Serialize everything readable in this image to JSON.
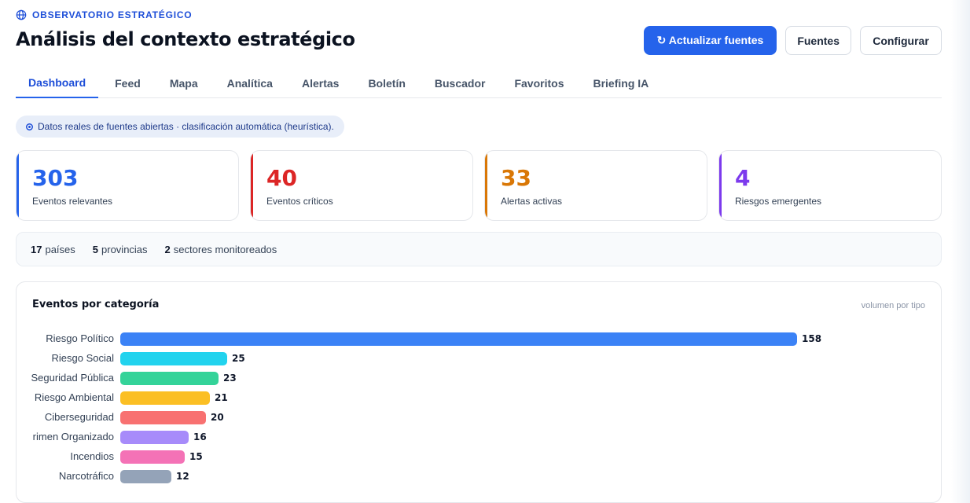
{
  "header": {
    "eyebrow": "OBSERVATORIO ESTRATÉGICO",
    "title": "Análisis del contexto estratégico",
    "actions": {
      "refresh": "↻ Actualizar fuentes",
      "sources": "Fuentes",
      "configure": "Configurar"
    },
    "accent": "#2563eb"
  },
  "tabs": [
    {
      "label": "Dashboard",
      "active": true
    },
    {
      "label": "Feed"
    },
    {
      "label": "Mapa"
    },
    {
      "label": "Analítica"
    },
    {
      "label": "Alertas"
    },
    {
      "label": "Boletín"
    },
    {
      "label": "Buscador"
    },
    {
      "label": "Favoritos"
    },
    {
      "label": "Briefing IA"
    }
  ],
  "info": "Datos reales de fuentes abiertas · clasificación automática (heurística).",
  "stats": [
    {
      "value": "303",
      "label": "Eventos relevantes",
      "color": "#2563eb"
    },
    {
      "value": "40",
      "label": "Eventos críticos",
      "color": "#dc2626"
    },
    {
      "value": "33",
      "label": "Alertas activas",
      "color": "#d97706"
    },
    {
      "value": "4",
      "label": "Riesgos emergentes",
      "color": "#7c3aed"
    }
  ],
  "summary": {
    "countries_value": "17",
    "countries_label": "países",
    "provinces_value": "5",
    "provinces_label": "provincias",
    "sectors_value": "2",
    "sectors_label": "sectores monitoreados"
  },
  "panel": {
    "title": "Eventos por categoría",
    "subtitle": "volumen por tipo"
  },
  "chart_data": {
    "type": "bar",
    "orientation": "horizontal",
    "title": "Eventos por categoría",
    "categories": [
      "Riesgo Político",
      "Riesgo Social",
      "Seguridad Pública",
      "Riesgo Ambiental",
      "Ciberseguridad",
      "rimen Organizado",
      "Incendios",
      "Narcotráfico"
    ],
    "values": [
      158,
      25,
      23,
      21,
      20,
      16,
      15,
      12
    ],
    "colors": [
      "#3b82f6",
      "#22d3ee",
      "#34d399",
      "#fbbf24",
      "#f87171",
      "#a78bfa",
      "#f472b6",
      "#94a3b8"
    ],
    "xlim": [
      0,
      158
    ],
    "grid": false
  }
}
